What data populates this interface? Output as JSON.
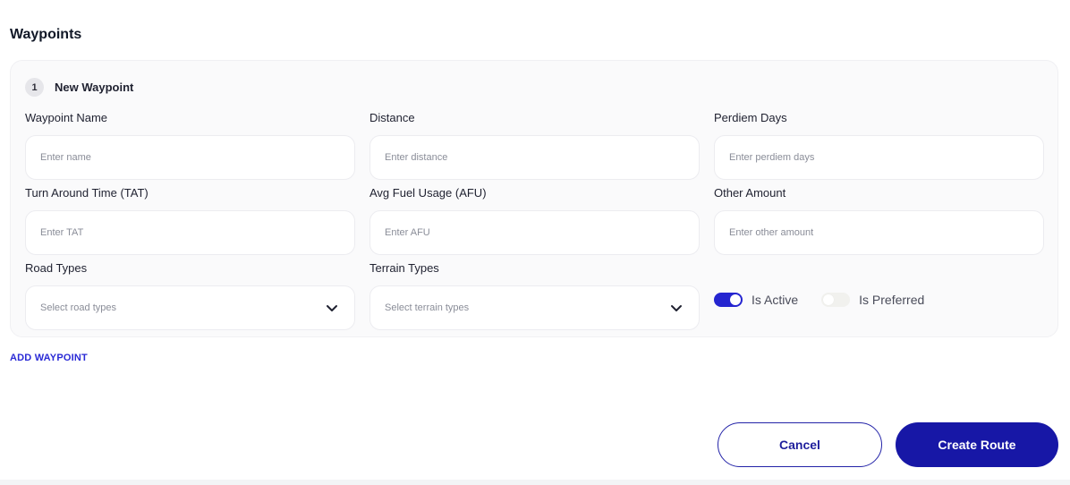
{
  "section": {
    "title": "Waypoints"
  },
  "waypoint": {
    "index": "1",
    "title": "New Waypoint",
    "fields": {
      "name": {
        "label": "Waypoint Name",
        "placeholder": "Enter name"
      },
      "distance": {
        "label": "Distance",
        "placeholder": "Enter distance"
      },
      "perdiem": {
        "label": "Perdiem Days",
        "placeholder": "Enter perdiem days"
      },
      "tat": {
        "label": "Turn Around Time (TAT)",
        "placeholder": "Enter TAT"
      },
      "afu": {
        "label": "Avg Fuel Usage (AFU)",
        "placeholder": "Enter AFU"
      },
      "other": {
        "label": "Other Amount",
        "placeholder": "Enter other amount"
      },
      "road_types": {
        "label": "Road Types",
        "placeholder": "Select road types",
        "icon": "chevron-down-icon"
      },
      "terrain_types": {
        "label": "Terrain Types",
        "placeholder": "Select terrain types",
        "icon": "chevron-down-icon"
      }
    },
    "toggles": {
      "is_active": {
        "label": "Is Active",
        "on": true
      },
      "is_preferred": {
        "label": "Is Preferred",
        "on": false
      }
    }
  },
  "actions": {
    "add_waypoint": "ADD WAYPOINT",
    "cancel": "Cancel",
    "create_route": "Create Route"
  },
  "colors": {
    "accent": "#1717a6",
    "link": "#2a2ad6",
    "toggle_on": "#2525d0"
  }
}
